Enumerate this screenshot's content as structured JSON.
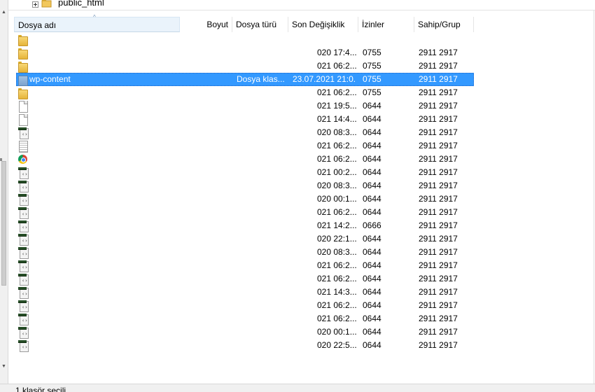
{
  "tree": {
    "label": "public_html"
  },
  "columns": [
    {
      "label": "Dosya adı"
    },
    {
      "label": "Boyut"
    },
    {
      "label": "Dosya türü"
    },
    {
      "label": "Son Değişiklik"
    },
    {
      "label": "İzinler"
    },
    {
      "label": "Sahip/Grup"
    }
  ],
  "rows": [
    {
      "icon": "folder-icon",
      "name": "",
      "type": "",
      "date": "",
      "perm": "",
      "owner": ""
    },
    {
      "icon": "folder-icon",
      "name": "",
      "type": "",
      "date": "020 17:4...",
      "perm": "0755",
      "owner": "2911 2917"
    },
    {
      "icon": "folder-icon",
      "name": "",
      "type": "",
      "date": "021 06:2...",
      "perm": "0755",
      "owner": "2911 2917"
    },
    {
      "icon": "folder-icon",
      "name": "wp-content",
      "type": "Dosya klas...",
      "date": "23.07.2021 21:0...",
      "perm": "0755",
      "owner": "2911 2917",
      "selected": true
    },
    {
      "icon": "folder-icon",
      "name": "",
      "type": "",
      "date": "021 06:2...",
      "perm": "0755",
      "owner": "2911 2917"
    },
    {
      "icon": "file-icon",
      "name": "",
      "type": "",
      "date": "021 19:5...",
      "perm": "0644",
      "owner": "2911 2917"
    },
    {
      "icon": "file-icon",
      "name": "",
      "type": "",
      "date": "021 14:4...",
      "perm": "0644",
      "owner": "2911 2917"
    },
    {
      "icon": "code-file-icon",
      "name": "",
      "type": "",
      "date": "020 08:3...",
      "perm": "0644",
      "owner": "2911 2917"
    },
    {
      "icon": "text-file-icon",
      "name": "",
      "type": "",
      "date": "021 06:2...",
      "perm": "0644",
      "owner": "2911 2917"
    },
    {
      "icon": "chrome-icon",
      "name": "",
      "type": "",
      "date": "021 06:2...",
      "perm": "0644",
      "owner": "2911 2917"
    },
    {
      "icon": "code-file-icon",
      "name": "",
      "type": "",
      "date": "021 00:2...",
      "perm": "0644",
      "owner": "2911 2917"
    },
    {
      "icon": "code-file-icon",
      "name": "",
      "type": "",
      "date": "020 08:3...",
      "perm": "0644",
      "owner": "2911 2917"
    },
    {
      "icon": "code-file-icon",
      "name": "",
      "type": "",
      "date": "020 00:1...",
      "perm": "0644",
      "owner": "2911 2917"
    },
    {
      "icon": "code-file-icon",
      "name": "",
      "type": "",
      "date": "021 06:2...",
      "perm": "0644",
      "owner": "2911 2917"
    },
    {
      "icon": "code-file-icon",
      "name": "",
      "type": "",
      "date": "021 14:2...",
      "perm": "0666",
      "owner": "2911 2917"
    },
    {
      "icon": "code-file-icon",
      "name": "",
      "type": "",
      "date": "020 22:1...",
      "perm": "0644",
      "owner": "2911 2917"
    },
    {
      "icon": "code-file-icon",
      "name": "",
      "type": "",
      "date": "020 08:3...",
      "perm": "0644",
      "owner": "2911 2917"
    },
    {
      "icon": "code-file-icon",
      "name": "",
      "type": "",
      "date": "021 06:2...",
      "perm": "0644",
      "owner": "2911 2917"
    },
    {
      "icon": "code-file-icon",
      "name": "",
      "type": "",
      "date": "021 06:2...",
      "perm": "0644",
      "owner": "2911 2917"
    },
    {
      "icon": "code-file-icon",
      "name": "",
      "type": "",
      "date": "021 14:3...",
      "perm": "0644",
      "owner": "2911 2917"
    },
    {
      "icon": "code-file-icon",
      "name": "",
      "type": "",
      "date": "021 06:2...",
      "perm": "0644",
      "owner": "2911 2917"
    },
    {
      "icon": "code-file-icon",
      "name": "",
      "type": "",
      "date": "021 06:2...",
      "perm": "0644",
      "owner": "2911 2917"
    },
    {
      "icon": "code-file-icon",
      "name": "",
      "type": "",
      "date": "020 00:1...",
      "perm": "0644",
      "owner": "2911 2917"
    },
    {
      "icon": "code-file-icon",
      "name": "",
      "type": "",
      "date": "020 22:5...",
      "perm": "0644",
      "owner": "2911 2917"
    }
  ],
  "status": {
    "text": "1 klasör seçili."
  },
  "colors": {
    "selection": "#3399ff",
    "header_active": "#eaf3fb",
    "folder": "#f0c75a"
  }
}
